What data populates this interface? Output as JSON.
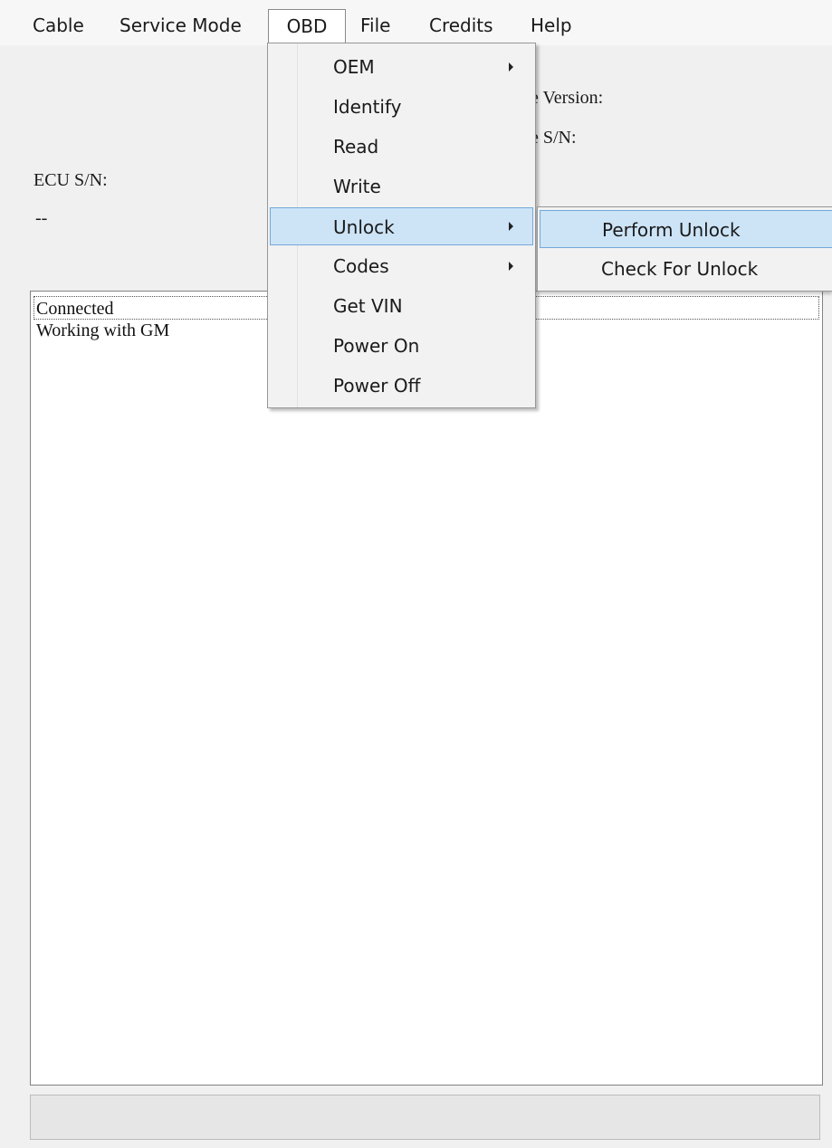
{
  "menubar": {
    "items": [
      {
        "label": "Cable"
      },
      {
        "label": "Service Mode"
      },
      {
        "label": "OBD"
      },
      {
        "label": "File"
      },
      {
        "label": "Credits"
      },
      {
        "label": "Help"
      }
    ]
  },
  "info": {
    "version_label": "e Version:",
    "sn_label": "e S/N:",
    "ecu_sn_label": "ECU S/N:",
    "ecu_sn_value": "--"
  },
  "obd_menu": {
    "items": [
      {
        "label": "OEM",
        "submenu": true
      },
      {
        "label": "Identify",
        "submenu": false
      },
      {
        "label": "Read",
        "submenu": false
      },
      {
        "label": "Write",
        "submenu": false
      },
      {
        "label": "Unlock",
        "submenu": true,
        "highlighted": true
      },
      {
        "label": "Codes",
        "submenu": true
      },
      {
        "label": "Get VIN",
        "submenu": false
      },
      {
        "label": "Power On",
        "submenu": false
      },
      {
        "label": "Power Off",
        "submenu": false
      }
    ]
  },
  "unlock_submenu": {
    "items": [
      {
        "label": "Perform Unlock",
        "highlighted": true
      },
      {
        "label": "Check For Unlock"
      }
    ]
  },
  "log": {
    "lines": [
      "Connected",
      "Working with GM"
    ]
  },
  "colors": {
    "highlight_fill": "#cde4f7",
    "highlight_border": "#74a8d8"
  }
}
